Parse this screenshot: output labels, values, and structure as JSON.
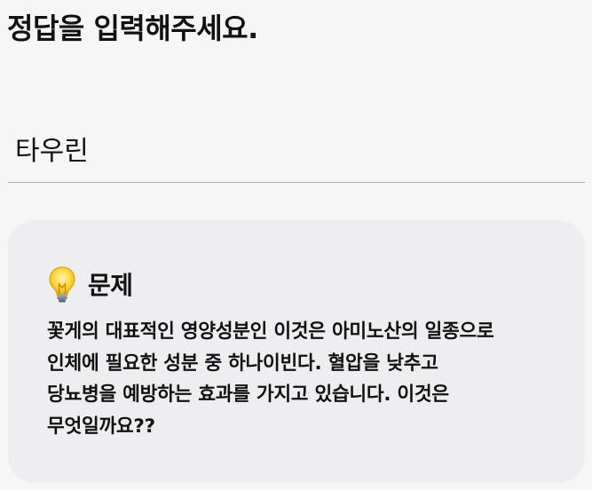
{
  "prompt": {
    "title": "정답을 입력해주세요."
  },
  "answer": {
    "value": "타우린"
  },
  "question": {
    "icon": "lightbulb-icon",
    "title": "문제",
    "lines": [
      "꽃게의 대표적인 영양성분인 이것은 아미노산의 일종으로",
      "인체에 필요한 성분 중 하나이빈다. 혈압을 낮추고",
      "당뇨병을 예방하는 효과를 가지고 있습니다. 이것은",
      "무엇일까요??"
    ]
  },
  "colors": {
    "background": "#f6f6f6",
    "card": "#eeeef0",
    "underline": "#a9a9c0",
    "text": "#111111"
  }
}
